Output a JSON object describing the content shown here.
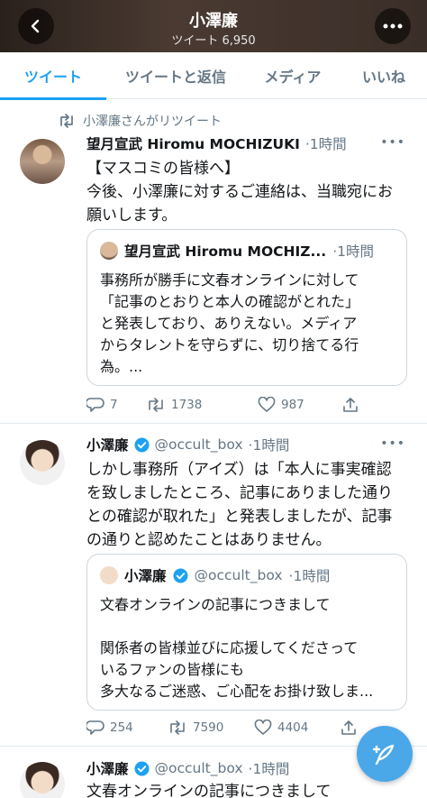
{
  "header": {
    "title": "小澤廉",
    "subtitle": "ツイート 6,950"
  },
  "tabs": [
    "ツイート",
    "ツイートと返信",
    "メディア",
    "いいね"
  ],
  "tweets": [
    {
      "retweet_label": "小澤廉さんがリツイート",
      "name": "望月宣武 Hiromu MOCHIZUKI",
      "meta": "·1時間",
      "text": [
        "【マスコミの皆様へ】",
        "今後、小澤廉に対するご連絡は、当職宛にお",
        "願いします。"
      ],
      "quote": {
        "name": "望月宣武 Hiromu MOCHIZ...",
        "meta": "·1時間",
        "text": "事務所が勝手に文春オンラインに対して\n「記事のとおりと本人の確認がとれた」\nと発表しており、ありえない。メディア\nからタレントを守らずに、切り捨てる行\n為。..."
      },
      "replies": "7",
      "retweets": "1738",
      "likes": "987"
    },
    {
      "name": "小澤廉",
      "handle": "@occult_box",
      "meta": "·1時間",
      "text": [
        "しかし事務所（アイズ）は「本人に事実確認",
        "を致しましたところ、記事にありました通り",
        "との確認が取れた」と発表しましたが、記事",
        "の通りと認めたことはありません。"
      ],
      "quote": {
        "name": "小澤廉",
        "handle": "@occult_box",
        "meta": "·1時間",
        "text": "文春オンラインの記事につきまして\n\n関係者の皆様並びに応援してくださって\nいるファンの皆様にも\n多大なるご迷惑、ご心配をお掛け致しま..."
      },
      "replies": "254",
      "retweets": "7590",
      "likes": "4404"
    },
    {
      "name": "小澤廉",
      "handle": "@occult_box",
      "meta": "·1時間",
      "text": [
        "文春オンラインの記事につきまして"
      ]
    }
  ],
  "colors": {
    "accent": "#1da1f2",
    "muted": "#657786",
    "fab": "#4aa8e8"
  }
}
